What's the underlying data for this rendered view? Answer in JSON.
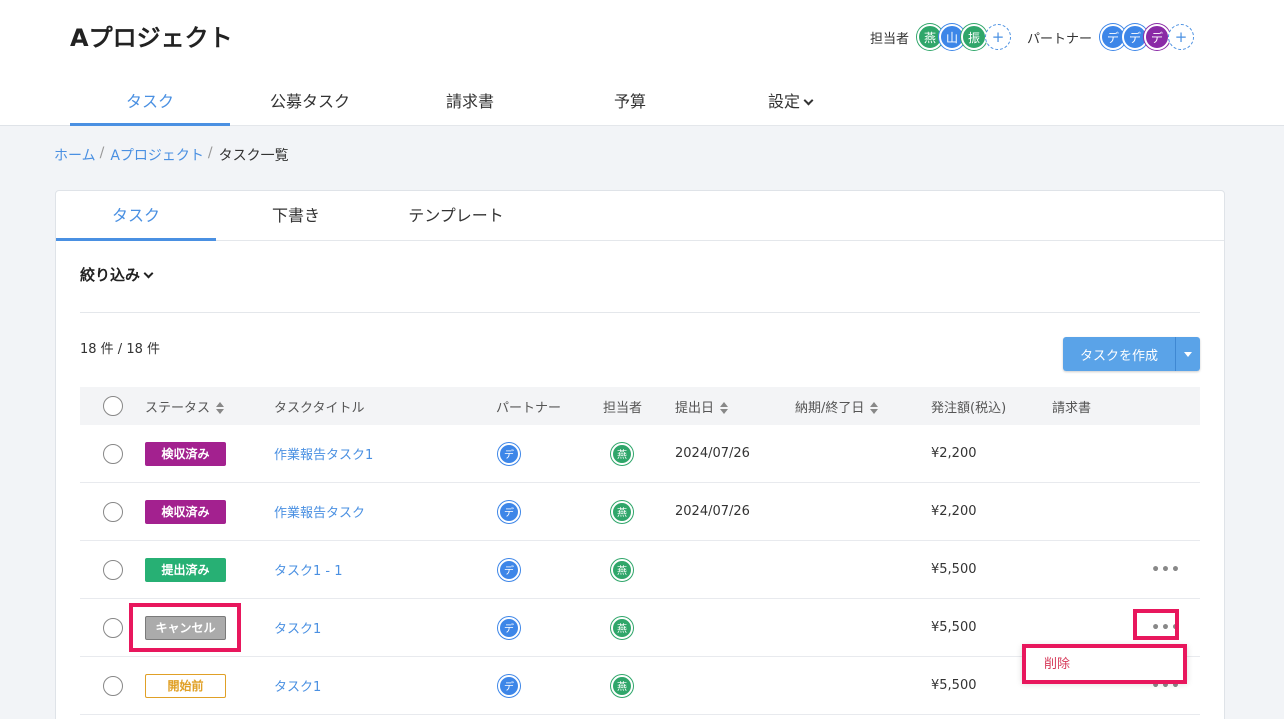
{
  "project": {
    "title": "Aプロジェクト"
  },
  "members": {
    "assignee_label": "担当者",
    "assignees": [
      {
        "initial": "燕",
        "color": "#2fa66a"
      },
      {
        "initial": "山",
        "color": "#3d86e8"
      },
      {
        "initial": "振",
        "color": "#2fa66a"
      }
    ],
    "partner_label": "パートナー",
    "partners": [
      {
        "initial": "デ",
        "color": "#3d86e8"
      },
      {
        "initial": "デ",
        "color": "#3d86e8"
      },
      {
        "initial": "デ",
        "color": "#8a2aa6"
      }
    ],
    "add_symbol": "+"
  },
  "nav": {
    "tabs": [
      {
        "label": "タスク",
        "active": true
      },
      {
        "label": "公募タスク"
      },
      {
        "label": "請求書"
      },
      {
        "label": "予算"
      },
      {
        "label": "設定"
      }
    ]
  },
  "breadcrumb": {
    "items": [
      "ホーム",
      "Aプロジェクト",
      "タスク一覧"
    ],
    "separator": "/"
  },
  "subtabs": [
    {
      "label": "タスク",
      "active": true
    },
    {
      "label": "下書き"
    },
    {
      "label": "テンプレート"
    }
  ],
  "filter": {
    "label": "絞り込み"
  },
  "count": {
    "text": "18 件 / 18 件"
  },
  "create_button": {
    "label": "タスクを作成"
  },
  "table": {
    "headers": {
      "status": "ステータス",
      "title": "タスクタイトル",
      "partner": "パートナー",
      "assignee": "担当者",
      "submitted": "提出日",
      "due": "納期/終了日",
      "amount": "発注額(税込)",
      "invoice": "請求書"
    },
    "rows": [
      {
        "status": "検収済み",
        "title": "作業報告タスク1",
        "partner": "デ",
        "assignee": "燕",
        "submitted": "2024/07/26",
        "due": "",
        "amount": "¥2,200",
        "invoice": "",
        "menu": ""
      },
      {
        "status": "検収済み",
        "title": "作業報告タスク",
        "partner": "デ",
        "assignee": "燕",
        "submitted": "2024/07/26",
        "due": "",
        "amount": "¥2,200",
        "invoice": "",
        "menu": ""
      },
      {
        "status": "提出済み",
        "title": "タスク1 - 1",
        "partner": "デ",
        "assignee": "燕",
        "submitted": "",
        "due": "",
        "amount": "¥5,500",
        "invoice": "",
        "menu": "•••"
      },
      {
        "status": "キャンセル",
        "title": "タスク1",
        "partner": "デ",
        "assignee": "燕",
        "submitted": "",
        "due": "",
        "amount": "¥5,500",
        "invoice": "",
        "menu": "•••"
      },
      {
        "status": "開始前",
        "title": "タスク1",
        "partner": "デ",
        "assignee": "燕",
        "submitted": "",
        "due": "",
        "amount": "¥5,500",
        "invoice": "",
        "menu": "•••"
      }
    ]
  },
  "dropdown": {
    "delete_label": "削除"
  },
  "colors": {
    "accent": "#4a90e2",
    "highlight": "#e8175d",
    "inspected": "#a3218f",
    "submitted": "#27b074",
    "cancelled": "#ababab",
    "not_started": "#e0a026"
  }
}
